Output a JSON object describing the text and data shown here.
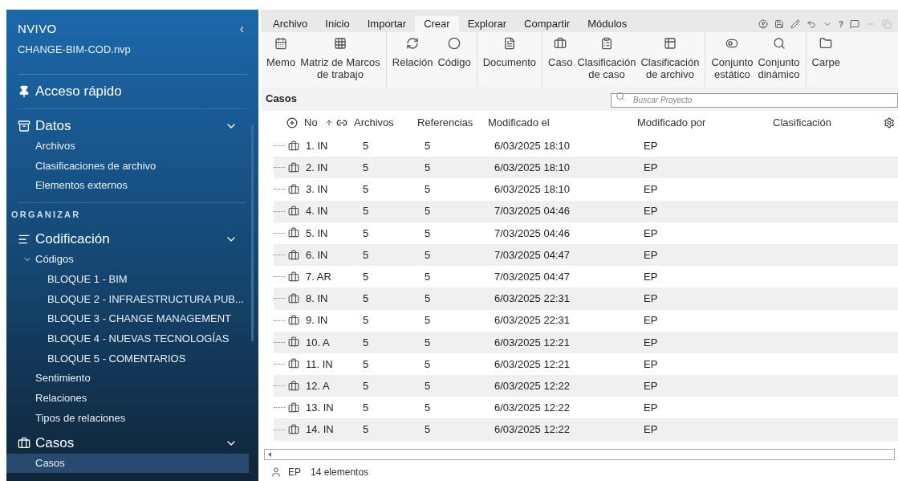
{
  "app": {
    "logo": "NVIVO",
    "project": "CHANGE-BIM-COD.nvp",
    "collapse": "‹"
  },
  "sidebar": {
    "quick_access": "Acceso rápido",
    "sections": [
      {
        "kind": "group",
        "title": "Datos",
        "expanded": true,
        "items": [
          {
            "label": "Archivos",
            "selected": false
          },
          {
            "label": "Clasificaciones de archivo",
            "selected": false
          },
          {
            "label": "Elementos externos",
            "selected": false
          }
        ]
      },
      {
        "kind": "heading",
        "title": "ORGANIZAR"
      },
      {
        "kind": "group",
        "title": "Codificación",
        "expanded": true,
        "items": [
          {
            "label": "Códigos",
            "selected": false,
            "expanded": true,
            "children": [
              {
                "label": "BLOQUE 1 - BIM",
                "selected": false
              },
              {
                "label": "BLOQUE 2  -  INFRAESTRUCTURA PUB...",
                "selected": false
              },
              {
                "label": "BLOQUE 3 - CHANGE MANAGEMENT",
                "selected": false
              },
              {
                "label": "BLOQUE 4 - NUEVAS TECNOLOGÍAS",
                "selected": false
              },
              {
                "label": "BLOQUE 5 - COMENTARIOS",
                "selected": false
              }
            ]
          },
          {
            "label": "Sentimiento",
            "selected": false
          },
          {
            "label": "Relaciones",
            "selected": false
          },
          {
            "label": "Tipos de relaciones",
            "selected": false
          }
        ]
      },
      {
        "kind": "group",
        "title": "Casos",
        "expanded": true,
        "items": [
          {
            "label": "Casos",
            "selected": true
          }
        ]
      }
    ]
  },
  "ribbon_tabs": [
    {
      "label": "Archivo",
      "selected": false
    },
    {
      "label": "Inicio",
      "selected": false
    },
    {
      "label": "Importar",
      "selected": false
    },
    {
      "label": "Crear",
      "selected": true
    },
    {
      "label": "Explorar",
      "selected": false
    },
    {
      "label": "Compartir",
      "selected": false
    },
    {
      "label": "Módulos",
      "selected": false
    }
  ],
  "quick_toolbar": {
    "help": "?"
  },
  "ribbon_groups": [
    [
      {
        "label": "Memo"
      },
      {
        "label": "Matriz de Marcos\nde trabajo"
      }
    ],
    [
      {
        "label": "Relación"
      },
      {
        "label": "Código"
      }
    ],
    [
      {
        "label": "Documento"
      }
    ],
    [
      {
        "label": "Caso"
      },
      {
        "label": "Clasificación\nde caso"
      },
      {
        "label": "Clasificación\nde archivo"
      }
    ],
    [
      {
        "label": "Conjunto\nestático"
      },
      {
        "label": "Conjunto\ndinámico"
      }
    ],
    [
      {
        "label": "Carpe"
      }
    ]
  ],
  "list": {
    "title": "Casos",
    "search_placeholder": "Buscar Proyecto",
    "columns": [
      "No",
      "Archivos",
      "Referencias",
      "Modificado el",
      "Modificado por",
      "Clasificación"
    ],
    "rows": [
      [
        "1. IN",
        "5",
        "5",
        "6/03/2025 18:10",
        "EP"
      ],
      [
        "2. IN",
        "5",
        "5",
        "6/03/2025 18:10",
        "EP"
      ],
      [
        "3. IN",
        "5",
        "5",
        "6/03/2025 18:10",
        "EP"
      ],
      [
        "4. IN",
        "5",
        "5",
        "7/03/2025 04:46",
        "EP"
      ],
      [
        "5. IN",
        "5",
        "5",
        "7/03/2025 04:46",
        "EP"
      ],
      [
        "6. IN",
        "5",
        "5",
        "7/03/2025 04:47",
        "EP"
      ],
      [
        "7. AR",
        "5",
        "5",
        "7/03/2025 04:47",
        "EP"
      ],
      [
        "8. IN",
        "5",
        "5",
        "6/03/2025 22:31",
        "EP"
      ],
      [
        "9. IN",
        "5",
        "5",
        "6/03/2025 22:31",
        "EP"
      ],
      [
        "10. A",
        "5",
        "5",
        "6/03/2025 12:21",
        "EP"
      ],
      [
        "11. IN",
        "5",
        "5",
        "6/03/2025 12:21",
        "EP"
      ],
      [
        "12. A",
        "5",
        "5",
        "6/03/2025 12:22",
        "EP"
      ],
      [
        "13. IN",
        "5",
        "5",
        "6/03/2025 12:22",
        "EP"
      ],
      [
        "14. IN",
        "5",
        "5",
        "6/03/2025 12:22",
        "EP"
      ]
    ]
  },
  "status_bar": {
    "user": "EP",
    "count": "14 elementos"
  }
}
